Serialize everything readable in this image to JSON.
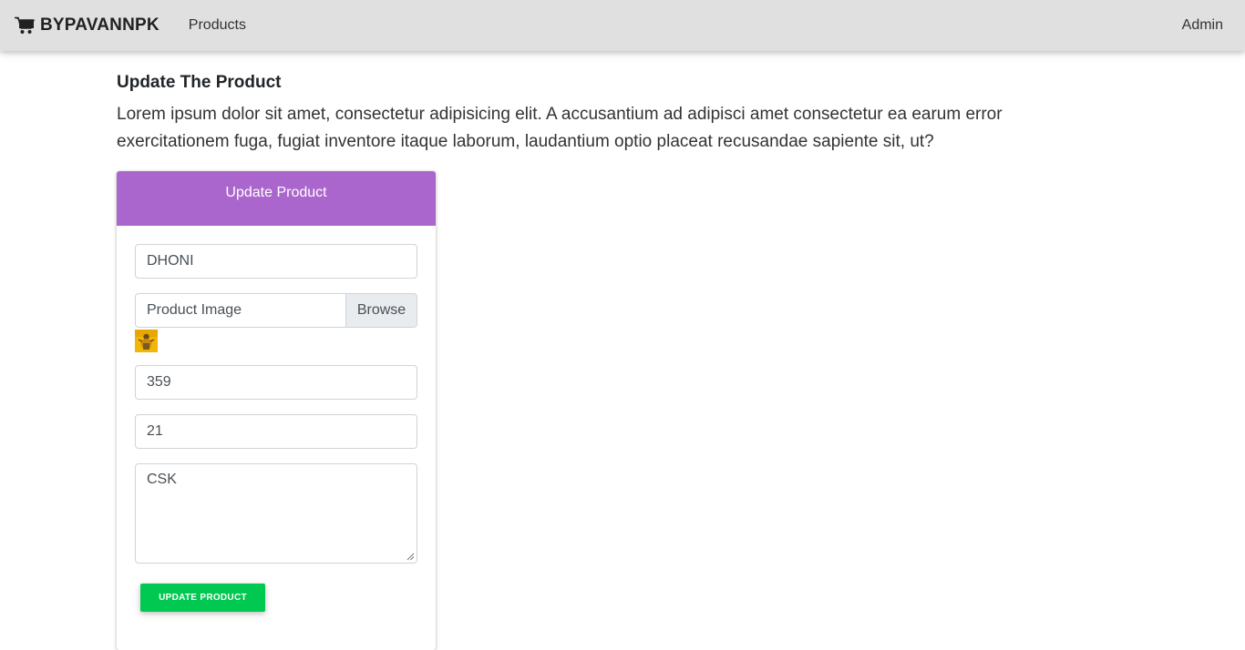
{
  "navbar": {
    "brand": "BYPAVANNPK",
    "brand_icon": "shopping-cart-icon",
    "links": [
      "Products"
    ],
    "right_link": "Admin"
  },
  "page": {
    "title": "Update The Product",
    "description": "Lorem ipsum dolor sit amet, consectetur adipisicing elit. A accusantium ad adipisci amet consectetur ea earum error exercitationem fuga, fugiat inventore itaque laborum, laudantium optio placeat recusandae sapiente sit, ut?"
  },
  "form": {
    "header": "Update Product",
    "name_value": "DHONI",
    "image_label": "Product Image",
    "browse_label": "Browse",
    "price_value": "359",
    "quantity_value": "21",
    "description_value": "CSK",
    "submit_label": "UPDATE PRODUCT"
  },
  "colors": {
    "navbar_bg": "#e0e0e0",
    "card_header": "#aa66cc",
    "submit_button": "#00c851"
  }
}
